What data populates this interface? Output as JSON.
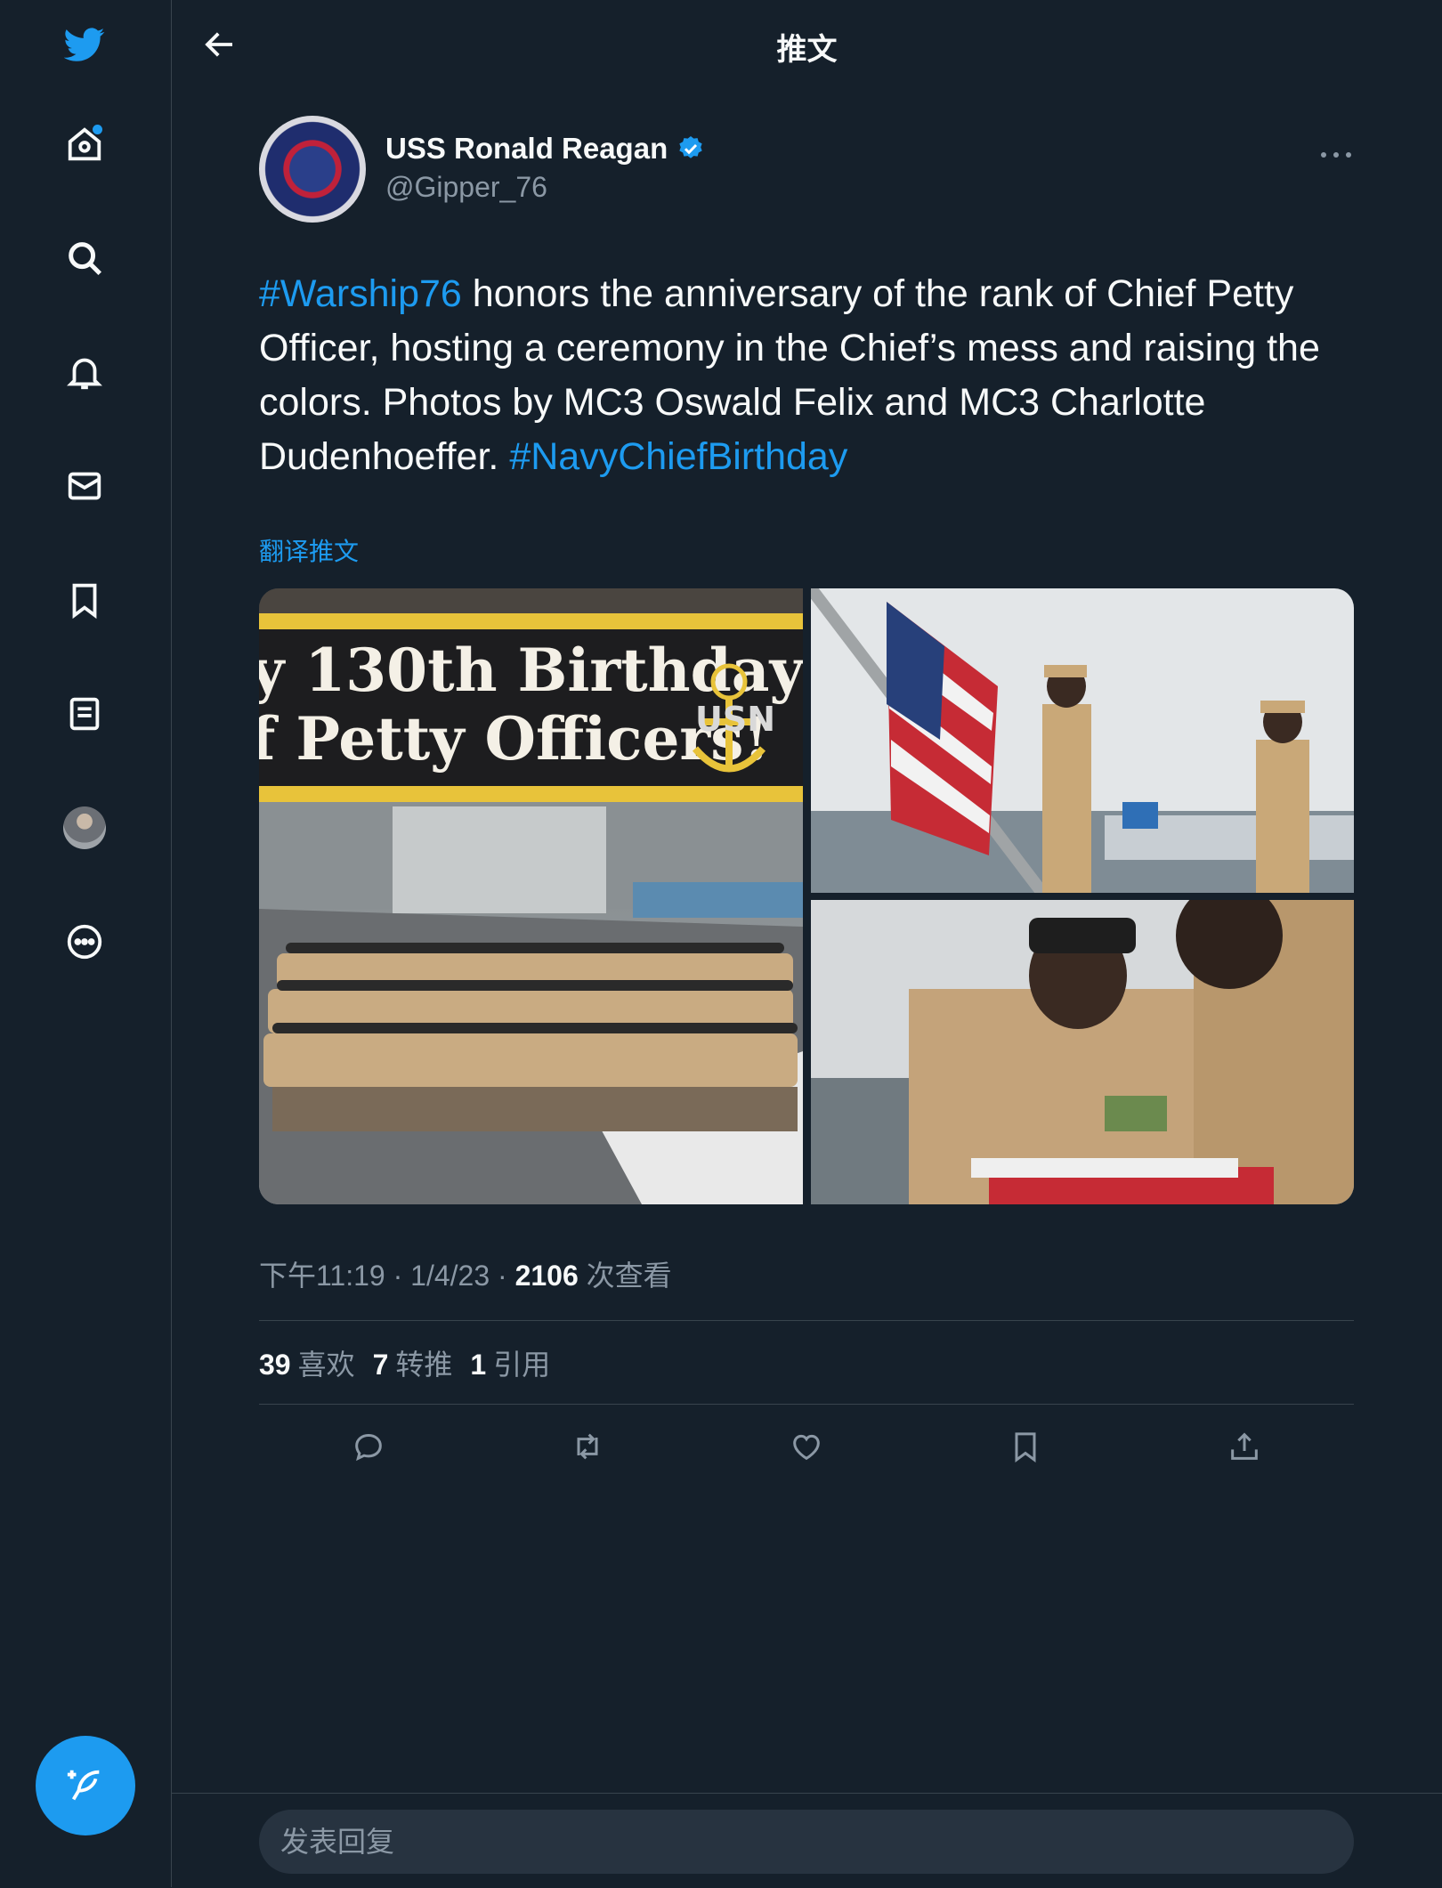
{
  "sidebar": {
    "items": [
      {
        "icon": "twitter-bird-icon"
      },
      {
        "icon": "home-icon",
        "has_notification_dot": true
      },
      {
        "icon": "search-icon"
      },
      {
        "icon": "bell-icon"
      },
      {
        "icon": "mail-icon"
      },
      {
        "icon": "bookmark-icon"
      },
      {
        "icon": "list-icon"
      },
      {
        "icon": "profile-avatar"
      },
      {
        "icon": "more-circle-icon"
      }
    ],
    "compose_icon": "compose-feather-icon"
  },
  "header": {
    "title": "推文",
    "back_icon": "arrow-left-icon"
  },
  "tweet": {
    "author_name": "USS Ronald Reagan",
    "verified": true,
    "handle": "@Gipper_76",
    "text_parts": {
      "hashtag1": "#Warship76",
      "body": " honors the anniversary of the rank of Chief Petty Officer, hosting a ceremony in the Chief’s mess and raising the colors. Photos by MC3 Oswald Felix and MC3 Charlotte Dudenhoeffer. ",
      "hashtag2": "#NavyChiefBirthday"
    },
    "translate_label": "翻译推文",
    "media": {
      "banner_line1": "y 130th Birthday",
      "banner_line2": "f Petty Officers!",
      "badge_text": "USN"
    },
    "meta": {
      "time": "下午11:19",
      "sep1": " · ",
      "date": "1/4/23",
      "sep2": " · ",
      "views_count": "2106",
      "views_label": " 次查看"
    },
    "stats": [
      {
        "count": "39",
        "label": "喜欢"
      },
      {
        "count": "7",
        "label": "转推"
      },
      {
        "count": "1",
        "label": "引用"
      }
    ],
    "actions": [
      "reply-icon",
      "retweet-icon",
      "like-icon",
      "bookmark-icon",
      "share-icon"
    ]
  },
  "reply": {
    "placeholder": "发表回复"
  },
  "colors": {
    "background": "#15202b",
    "accent": "#1d9bf0",
    "muted": "#8b98a5",
    "border": "#38444d"
  }
}
